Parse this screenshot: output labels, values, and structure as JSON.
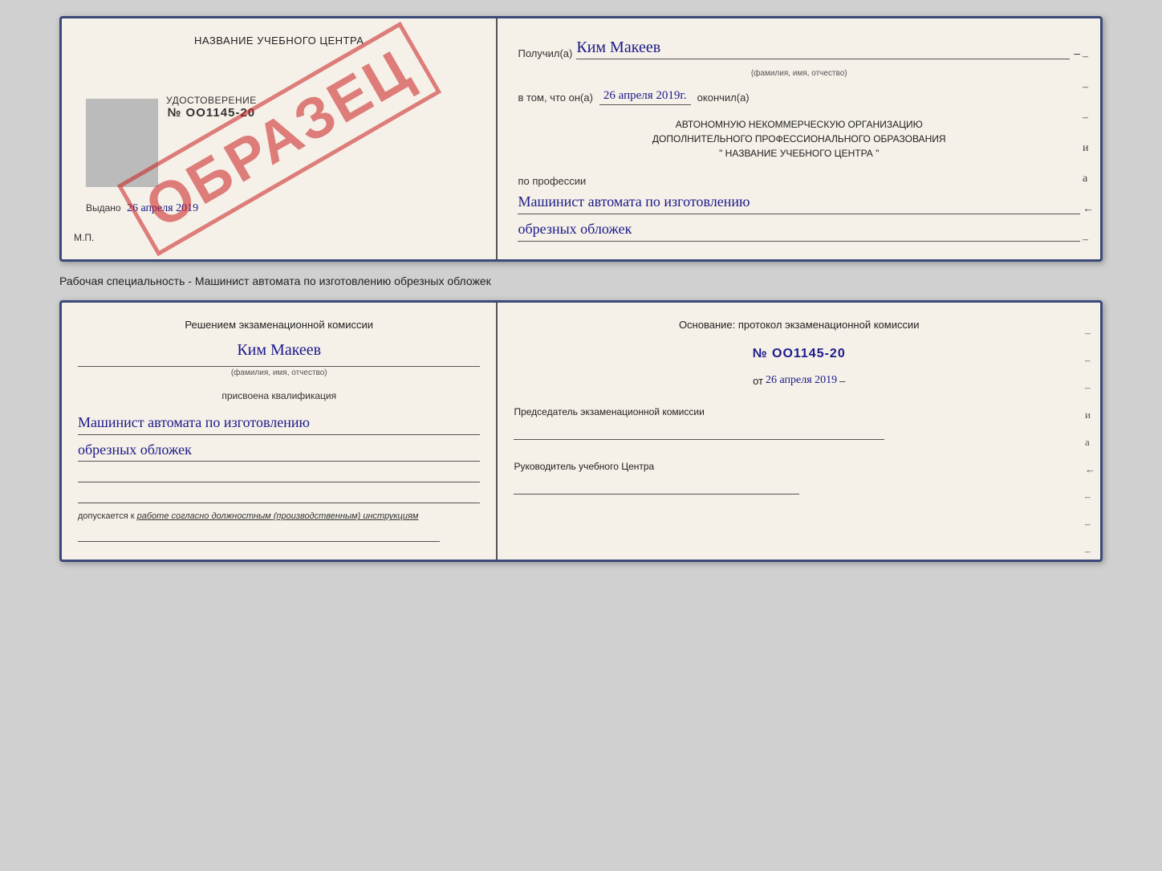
{
  "top_card": {
    "left": {
      "school_name": "НАЗВАНИЕ УЧЕБНОГО ЦЕНТРА",
      "watermark": "ОБРАЗЕЦ",
      "udostoverenie_label": "УДОСТОВЕРЕНИЕ",
      "udostoverenie_number": "№ OO1145-20",
      "vydano_label": "Выдано",
      "vydano_date": "26 апреля 2019",
      "mp_label": "М.П."
    },
    "right": {
      "poluchil_label": "Получил(а)",
      "poluchil_name": "Ким Макеев",
      "poluchil_subtitle": "(фамилия, имя, отчество)",
      "dash": "–",
      "vtom_label": "в том, что он(а)",
      "vtom_date": "26 апреля 2019г.",
      "okончил_label": "окончил(а)",
      "org_line1": "АВТОНОМНУЮ НЕКОММЕРЧЕСКУЮ ОРГАНИЗАЦИЮ",
      "org_line2": "ДОПОЛНИТЕЛЬНОГО ПРОФЕССИОНАЛЬНОГО ОБРАЗОВАНИЯ",
      "org_line3": "\" НАЗВАНИЕ УЧЕБНОГО ЦЕНТРА \"",
      "profession_label": "по профессии",
      "profession_handwritten1": "Машинист автомата по изготовлению",
      "profession_handwritten2": "обрезных обложек",
      "dashes": [
        "–",
        "–",
        "–",
        "и",
        "а",
        "←",
        "–",
        "–",
        "–",
        "–"
      ]
    }
  },
  "caption": "Рабочая специальность - Машинист автомата по изготовлению обрезных обложек",
  "bottom_card": {
    "left": {
      "resheniem_label": "Решением экзаменационной комиссии",
      "name_handwritten": "Ким Макеев",
      "name_subtitle": "(фамилия, имя, отчество)",
      "prisvoena_label": "присвоена квалификация",
      "kvali_handwritten1": "Машинист автомата по изготовлению",
      "kvali_handwritten2": "обрезных обложек",
      "dopuskaetsya_label": "допускается к",
      "dopuskaetsya_text": "работе согласно должностным (производственным) инструкциям"
    },
    "right": {
      "osnovanie_label": "Основание: протокол экзаменационной комиссии",
      "protocol_number": "№ OO1145-20",
      "ot_label": "от",
      "ot_date": "26 апреля 2019",
      "predsedatel_label": "Председатель экзаменационной комиссии",
      "rukovoditel_label": "Руководитель учебного Центра",
      "dashes": [
        "–",
        "–",
        "–",
        "и",
        "а",
        "←",
        "–",
        "–",
        "–",
        "–"
      ]
    }
  }
}
